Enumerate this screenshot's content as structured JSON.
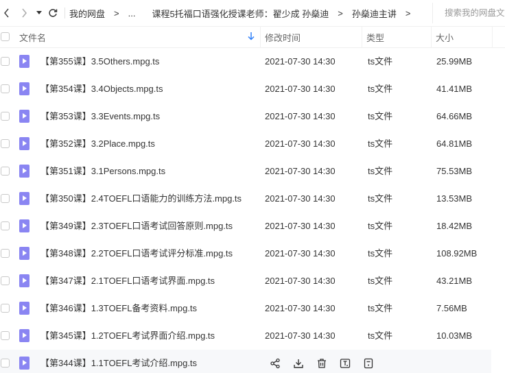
{
  "nav": {
    "back_icon": "chevron-left-icon",
    "forward_icon": "chevron-right-icon",
    "dropdown_icon": "caret-down-icon",
    "refresh_icon": "refresh-icon"
  },
  "breadcrumb": {
    "items": [
      "我的网盘",
      "...",
      "课程5托福口语强化授课老师：翟少成 孙燊迪",
      "孙燊迪主讲"
    ],
    "separator": ">"
  },
  "search": {
    "placeholder": "搜索我的网盘文件"
  },
  "columns": {
    "name": "文件名",
    "modified": "修改时间",
    "type": "类型",
    "size": "大小"
  },
  "colors": {
    "accent": "#2d7ff9",
    "file_icon": "#8a85f2",
    "hover_row": "#f7f8fa"
  },
  "files": [
    {
      "name": "【第355课】3.5Others.mpg.ts",
      "modified": "2021-07-30 14:30",
      "type": "ts文件",
      "size": "25.99MB"
    },
    {
      "name": "【第354课】3.4Objects.mpg.ts",
      "modified": "2021-07-30 14:30",
      "type": "ts文件",
      "size": "41.41MB"
    },
    {
      "name": "【第353课】3.3Events.mpg.ts",
      "modified": "2021-07-30 14:30",
      "type": "ts文件",
      "size": "64.66MB"
    },
    {
      "name": "【第352课】3.2Place.mpg.ts",
      "modified": "2021-07-30 14:30",
      "type": "ts文件",
      "size": "64.81MB"
    },
    {
      "name": "【第351课】3.1Persons.mpg.ts",
      "modified": "2021-07-30 14:30",
      "type": "ts文件",
      "size": "75.53MB"
    },
    {
      "name": "【第350课】2.4TOEFL口语能力的训练方法.mpg.ts",
      "modified": "2021-07-30 14:30",
      "type": "ts文件",
      "size": "13.53MB"
    },
    {
      "name": "【第349课】2.3TOEFL口语考试回答原则.mpg.ts",
      "modified": "2021-07-30 14:30",
      "type": "ts文件",
      "size": "18.42MB"
    },
    {
      "name": "【第348课】2.2TOEFL口语考试评分标准.mpg.ts",
      "modified": "2021-07-30 14:30",
      "type": "ts文件",
      "size": "108.92MB"
    },
    {
      "name": "【第347课】2.1TOEFL口语考试界面.mpg.ts",
      "modified": "2021-07-30 14:30",
      "type": "ts文件",
      "size": "43.21MB"
    },
    {
      "name": "【第346课】1.3TOEFL备考资料.mpg.ts",
      "modified": "2021-07-30 14:30",
      "type": "ts文件",
      "size": "7.56MB"
    },
    {
      "name": "【第345课】1.2TOEFL考试界面介绍.mpg.ts",
      "modified": "2021-07-30 14:30",
      "type": "ts文件",
      "size": "10.03MB"
    },
    {
      "name": "【第344课】1.1TOEFL考试介绍.mpg.ts",
      "hover": true
    }
  ],
  "row_actions": [
    "share-icon",
    "download-icon",
    "delete-icon",
    "text-extract-icon",
    "more-info-icon"
  ]
}
